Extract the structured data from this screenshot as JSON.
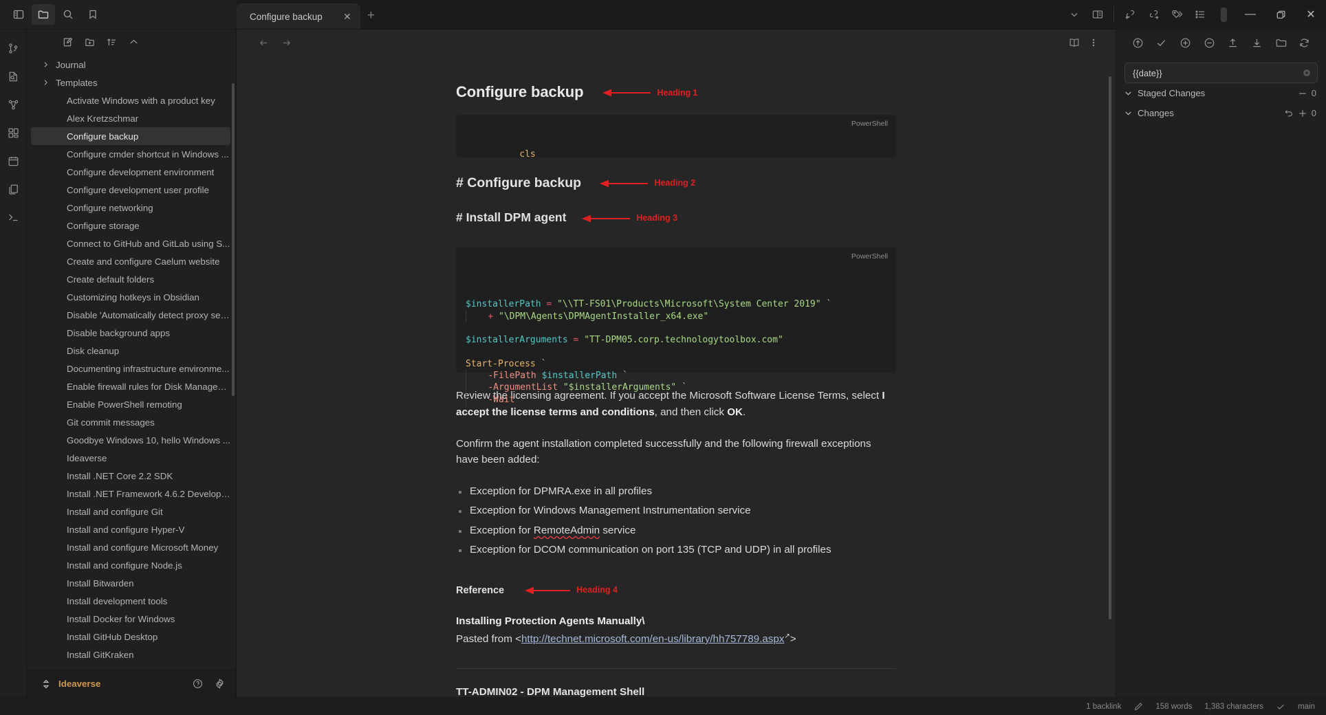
{
  "titlebar": {
    "left_icons": [
      {
        "name": "toggle-left-sidebar-icon",
        "active": false
      },
      {
        "name": "folder-icon",
        "active": true
      },
      {
        "name": "search-icon",
        "active": false
      },
      {
        "name": "bookmark-icon",
        "active": false
      }
    ],
    "tab": {
      "title": "Configure backup",
      "close_label": "✕",
      "new_tab_label": "+"
    },
    "right_icons": [
      {
        "name": "chevron-down-icon"
      },
      {
        "name": "split-pane-icon"
      },
      {
        "name": "link-backward-icon"
      },
      {
        "name": "link-forward-icon"
      },
      {
        "name": "tags-icon"
      },
      {
        "name": "outline-list-icon"
      },
      {
        "name": "right-sidebar-toggle-icon"
      }
    ],
    "window_controls": {
      "minimize": "—",
      "maximize": "❐",
      "close": "✕"
    }
  },
  "rail": {
    "icons": [
      {
        "name": "git-branch-icon"
      },
      {
        "name": "file-search-icon"
      },
      {
        "name": "graph-view-icon"
      },
      {
        "name": "canvas-grid-icon"
      },
      {
        "name": "calendar-icon"
      },
      {
        "name": "copy-files-icon"
      },
      {
        "name": "terminal-icon"
      }
    ]
  },
  "explorer": {
    "toolbar": [
      {
        "name": "new-note-icon"
      },
      {
        "name": "new-folder-icon"
      },
      {
        "name": "sort-order-icon"
      },
      {
        "name": "collapse-all-icon"
      }
    ],
    "folders": [
      {
        "label": "Journal"
      },
      {
        "label": "Templates"
      }
    ],
    "files": [
      {
        "label": "Activate Windows with a product key",
        "selected": false
      },
      {
        "label": "Alex Kretzschmar",
        "selected": false
      },
      {
        "label": "Configure backup",
        "selected": true
      },
      {
        "label": "Configure cmder shortcut in Windows ...",
        "selected": false
      },
      {
        "label": "Configure development environment",
        "selected": false
      },
      {
        "label": "Configure development user profile",
        "selected": false
      },
      {
        "label": "Configure networking",
        "selected": false
      },
      {
        "label": "Configure storage",
        "selected": false
      },
      {
        "label": "Connect to GitHub and GitLab using S...",
        "selected": false
      },
      {
        "label": "Create and configure Caelum website",
        "selected": false
      },
      {
        "label": "Create default folders",
        "selected": false
      },
      {
        "label": "Customizing hotkeys in Obsidian",
        "selected": false
      },
      {
        "label": "Disable 'Automatically detect proxy set...",
        "selected": false
      },
      {
        "label": "Disable background apps",
        "selected": false
      },
      {
        "label": "Disk cleanup",
        "selected": false
      },
      {
        "label": "Documenting infrastructure environme...",
        "selected": false
      },
      {
        "label": "Enable firewall rules for Disk Managem...",
        "selected": false
      },
      {
        "label": "Enable PowerShell remoting",
        "selected": false
      },
      {
        "label": "Git commit messages",
        "selected": false
      },
      {
        "label": "Goodbye Windows 10, hello Windows ...",
        "selected": false
      },
      {
        "label": "Ideaverse",
        "selected": false
      },
      {
        "label": "Install .NET Core 2.2 SDK",
        "selected": false
      },
      {
        "label": "Install .NET Framework 4.6.2 Developer...",
        "selected": false
      },
      {
        "label": "Install and configure Git",
        "selected": false
      },
      {
        "label": "Install and configure Hyper-V",
        "selected": false
      },
      {
        "label": "Install and configure Microsoft Money",
        "selected": false
      },
      {
        "label": "Install and configure Node.js",
        "selected": false
      },
      {
        "label": "Install Bitwarden",
        "selected": false
      },
      {
        "label": "Install development tools",
        "selected": false
      },
      {
        "label": "Install Docker for Windows",
        "selected": false
      },
      {
        "label": "Install GitHub Desktop",
        "selected": false
      },
      {
        "label": "Install GitKraken",
        "selected": false
      }
    ],
    "vault": {
      "name": "Ideaverse",
      "switch_icon": "vault-switch-icon",
      "help_icon": "help-icon",
      "settings_icon": "settings-gear-icon"
    }
  },
  "editor": {
    "nav": [
      {
        "name": "back-arrow-icon"
      },
      {
        "name": "forward-arrow-icon"
      }
    ],
    "actions": [
      {
        "name": "reading-view-icon"
      },
      {
        "name": "more-options-icon"
      }
    ],
    "document": {
      "h1": "Configure backup",
      "h1_annotation": "Heading 1",
      "code1": {
        "lang": "PowerShell",
        "text": "cls"
      },
      "h2": "# Configure backup",
      "h2_annotation": "Heading 2",
      "h3": "# Install DPM agent",
      "h3_annotation": "Heading 3",
      "code2": {
        "lang": "PowerShell",
        "lines": [
          "$installerPath = \"\\\\TT-FS01\\Products\\Microsoft\\System Center 2019\" `",
          "    + \"\\DPM\\Agents\\DPMAgentInstaller_x64.exe\"",
          "",
          "$installerArguments = \"TT-DPM05.corp.technologytoolbox.com\"",
          "",
          "Start-Process `",
          "    -FilePath $installerPath `",
          "    -ArgumentList \"$installerArguments\" `",
          "    -Wait"
        ]
      },
      "para1_a": "Review the licensing agreement. If you accept the Microsoft Software License Terms, select ",
      "para1_b": "I accept the license terms and conditions",
      "para1_c": ", and then click ",
      "para1_d": "OK",
      "para1_e": ".",
      "para2": "Confirm the agent installation completed successfully and the following firewall exceptions have been added:",
      "bullets": [
        "Exception for DPMRA.exe in all profiles",
        "Exception for Windows Management Instrumentation service",
        "Exception for RemoteAdmin service",
        "Exception for DCOM communication on port 135 (TCP and UDP) in all profiles"
      ],
      "bullet3_pre": "Exception for ",
      "bullet3_spell": "RemoteAdmin",
      "bullet3_post": " service",
      "h4": "Reference",
      "h4_annotation": "Heading 4",
      "ref_title": "Installing Protection Agents Manually\\",
      "ref_prefix": "Pasted from <",
      "ref_link": "http://technet.microsoft.com/en-us/library/hh757789.aspx",
      "ref_suffix": ">",
      "below_fold": "TT-ADMIN02 - DPM Management Shell"
    }
  },
  "rightpanel": {
    "toolbar": [
      {
        "name": "commit-push-icon"
      },
      {
        "name": "commit-check-icon"
      },
      {
        "name": "stage-all-icon"
      },
      {
        "name": "unstage-all-icon"
      },
      {
        "name": "push-icon"
      },
      {
        "name": "pull-icon"
      },
      {
        "name": "open-repo-icon"
      },
      {
        "name": "refresh-icon"
      }
    ],
    "search": {
      "value": "{{date}}",
      "placeholder": "{{date}}",
      "clear_icon": "clear-icon"
    },
    "groups": [
      {
        "name": "Staged Changes",
        "count": "0",
        "action_icon": "minus-icon"
      },
      {
        "name": "Changes",
        "count": "0",
        "action_icons": [
          "undo-icon",
          "plus-icon"
        ]
      }
    ]
  },
  "statusbar": {
    "backlinks": "1 backlink",
    "edit_icon": "pencil-icon",
    "words": "158 words",
    "characters": "1,383 characters",
    "sync_icon": "check-icon",
    "branch": "main"
  },
  "colors": {
    "accent_red": "#e02020",
    "vault_orange": "#d09a4e",
    "selection": "#333333"
  }
}
